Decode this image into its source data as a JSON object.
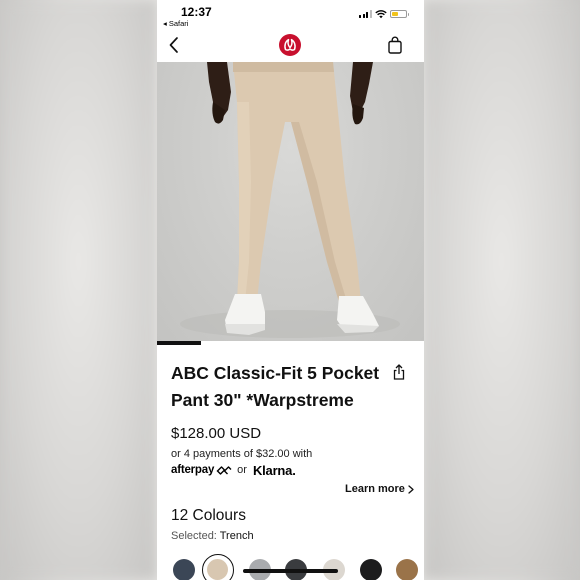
{
  "status_bar": {
    "time": "12:37",
    "back_app": "◂ Safari",
    "battery_color": "#f2c41b"
  },
  "nav": {
    "back_icon": "chevron-left-icon",
    "logo_icon": "lululemon-logo-icon",
    "logo_color": "#c8102e",
    "bag_icon": "shopping-bag-icon"
  },
  "carousel": {
    "active_slide": 1
  },
  "product": {
    "title": "ABC Classic-Fit 5 Pocket Pant 30\" *Warpstreme",
    "share_icon": "share-icon",
    "price": "$128.00 USD",
    "installments": "or 4 payments of $32.00 with",
    "afterpay": "afterpay",
    "or": "or",
    "klarna": "Klarna.",
    "learn_more": "Learn more",
    "colours_heading": "12 Colours",
    "selected_label": "Selected:",
    "selected_value": "Trench"
  },
  "swatches": [
    {
      "name": "navy",
      "color": "#3b4656",
      "selected": false
    },
    {
      "name": "trench",
      "color": "#d8c7b1",
      "selected": true
    },
    {
      "name": "grey",
      "color": "#a9abae",
      "selected": false
    },
    {
      "name": "charcoal",
      "color": "#3a3c3f",
      "selected": false
    },
    {
      "name": "light-bone",
      "color": "#dcd7d0",
      "selected": false
    },
    {
      "name": "black",
      "color": "#1c1c1d",
      "selected": false
    },
    {
      "name": "brown",
      "color": "#9a7349",
      "selected": false
    }
  ]
}
